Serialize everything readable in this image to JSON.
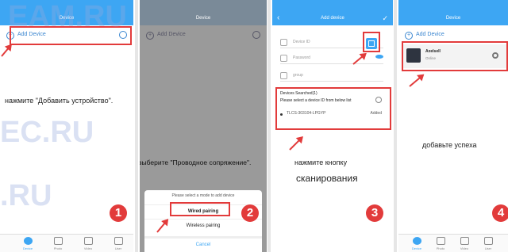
{
  "watermark": {
    "line1": "EAM.RU",
    "line2": "EC.RU",
    "line3": ".RU"
  },
  "panel1": {
    "header": "Device",
    "add_label": "Add Device",
    "caption": "нажмите \"Добавить устройство\".",
    "step": "1"
  },
  "panel2": {
    "header": "Device",
    "add_label": "Add Device",
    "caption": "выберите \"Проводное сопряжение\".",
    "sheet_title": "Please select a mode to add device",
    "wired": "Wired pairing",
    "wireless": "Wireless pairing",
    "cancel": "Cancel",
    "step": "2"
  },
  "panel3": {
    "header": "Add device",
    "device_id": "Device ID",
    "password": "Password",
    "group": "group",
    "searched_title": "Devices Searched(1)",
    "searched_hint": "Please select a device ID from below list",
    "device_item": "TLCS-303104-LPGYP",
    "added": "Added",
    "caption_line1": "нажмите кнопку",
    "caption_line2": "сканирования",
    "step": "3"
  },
  "panel4": {
    "header": "Device",
    "add_label": "Add Device",
    "device_name": "Axelsell",
    "device_status": "Online",
    "caption": "добавьте успеха",
    "step": "4"
  },
  "tabs": [
    "Device",
    "Photo",
    "Video",
    "User"
  ]
}
